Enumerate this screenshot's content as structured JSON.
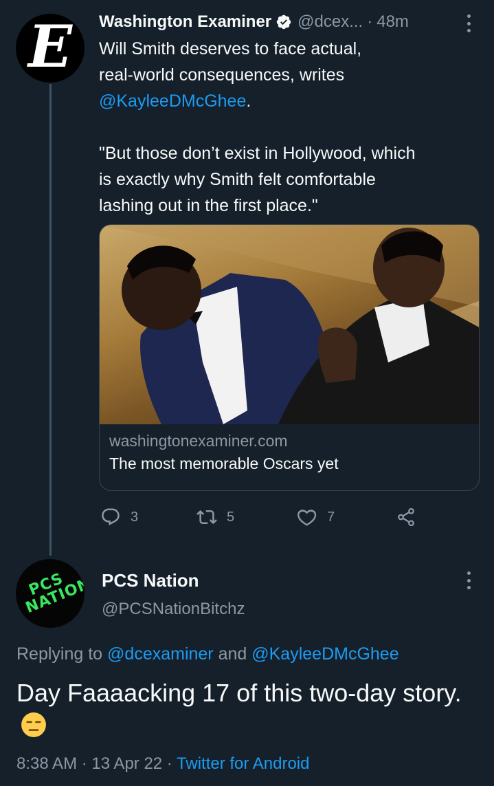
{
  "tweet1": {
    "avatar_letter": "E",
    "display_name": "Washington Examiner",
    "handle": "@dcex...",
    "separator": "·",
    "time": "48m",
    "body_line1": "Will Smith deserves to face actual,\nreal-world consequences, writes\n",
    "body_mention": "@KayleeDMcGhee",
    "body_after_mention": ".",
    "quote": "\"But those don’t exist in Hollywood, which\nis exactly why Smith felt comfortable\nlashing out in the first place.\"",
    "card": {
      "domain": "washingtonexaminer.com",
      "title": "The most memorable Oscars yet"
    },
    "actions": {
      "replies": "3",
      "retweets": "5",
      "likes": "7"
    }
  },
  "tweet2": {
    "avatar_text_line1": "PCS",
    "avatar_text_line2": "NATION",
    "display_name": "PCS Nation",
    "handle": "@PCSNationBitchz",
    "replying_prefix": "Replying to ",
    "replying_user1": "@dcexaminer",
    "replying_and": " and ",
    "replying_user2": "@KayleeDMcGhee",
    "text": "Day Faaaacking 17 of this two-day story.",
    "time": "8:38 AM",
    "date": "13 Apr 22",
    "separator": " · ",
    "source": "Twitter for Android"
  },
  "colors": {
    "background": "#15202b",
    "accent": "#1d9bf0",
    "secondary_text": "#8b98a5",
    "primary_text": "#f7f9f9",
    "logo_green": "#39e75f"
  },
  "icons": [
    "verified-badge-icon",
    "more-options-icon",
    "reply-icon",
    "retweet-icon",
    "like-icon",
    "share-icon",
    "expressionless-face-emoji"
  ]
}
